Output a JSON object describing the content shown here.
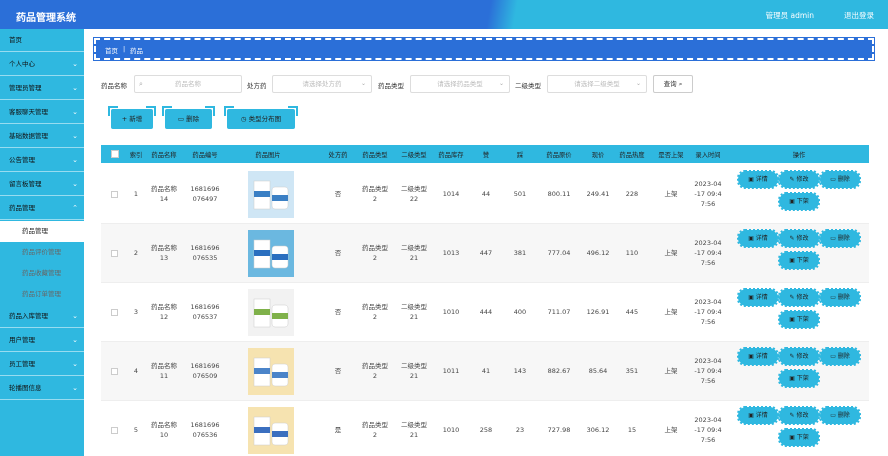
{
  "header": {
    "title": "药品管理系统",
    "user": "管理员 admin",
    "logout": "退出登录"
  },
  "sidebar": {
    "items": [
      {
        "label": "首页",
        "chevron": ""
      },
      {
        "label": "个人中心",
        "chevron": "⌄"
      },
      {
        "label": "管理员管理",
        "chevron": "⌄"
      },
      {
        "label": "客服聊天管理",
        "chevron": "⌄"
      },
      {
        "label": "基础数据管理",
        "chevron": "⌄"
      },
      {
        "label": "公告管理",
        "chevron": "⌄"
      },
      {
        "label": "留言板管理",
        "chevron": "⌄"
      },
      {
        "label": "药品管理",
        "chevron": "⌃"
      }
    ],
    "subitems": [
      "药品管理",
      "药品评价管理",
      "药品收藏管理",
      "药品订单管理"
    ],
    "items_after": [
      {
        "label": "药品入库管理",
        "chevron": "⌄"
      },
      {
        "label": "用户管理",
        "chevron": "⌄"
      },
      {
        "label": "员工管理",
        "chevron": "⌄"
      },
      {
        "label": "轮播图信息",
        "chevron": "⌄"
      }
    ]
  },
  "breadcrumb": {
    "home": "首页",
    "sep": "|",
    "current": "药品"
  },
  "search": {
    "name_label": "药品名称",
    "name_placeholder": "药品名称",
    "rx_label": "处方药",
    "rx_placeholder": "请选择处方药",
    "type_label": "药品类型",
    "type_placeholder": "请选择药品类型",
    "type2_label": "二级类型",
    "type2_placeholder": "请选择二级类型",
    "search_button": "查询"
  },
  "actions": {
    "add": "+ 新增",
    "delete": "删除",
    "chart": "类型分布图"
  },
  "table": {
    "headers": [
      "索引",
      "药品名称",
      "药品编号",
      "药品图片",
      "处方药",
      "药品类型",
      "二级类型",
      "药品库存",
      "赞",
      "踩",
      "药品原价",
      "现价",
      "药品热度",
      "是否上架",
      "录入时间",
      "操作"
    ],
    "op_labels": {
      "detail": "详情",
      "edit": "修改",
      "delete": "删除",
      "off": "下架"
    },
    "rows": [
      {
        "idx": "1",
        "name": "药品名称\n14",
        "code": "1681696\n076497",
        "rx": "否",
        "type": "药品类型\n2",
        "type2": "二级类型\n22",
        "stock": "1014",
        "up": "44",
        "down": "501",
        "price": "800.11",
        "now": "249.41",
        "hot": "228",
        "shelf": "上架",
        "time": "2023-04\n-17 09:4\n7:56"
      },
      {
        "idx": "2",
        "name": "药品名称\n13",
        "code": "1681696\n076535",
        "rx": "否",
        "type": "药品类型\n2",
        "type2": "二级类型\n21",
        "stock": "1013",
        "up": "447",
        "down": "381",
        "price": "777.04",
        "now": "496.12",
        "hot": "110",
        "shelf": "上架",
        "time": "2023-04\n-17 09:4\n7:56"
      },
      {
        "idx": "3",
        "name": "药品名称\n12",
        "code": "1681696\n076537",
        "rx": "否",
        "type": "药品类型\n2",
        "type2": "二级类型\n21",
        "stock": "1010",
        "up": "444",
        "down": "400",
        "price": "711.07",
        "now": "126.91",
        "hot": "445",
        "shelf": "上架",
        "time": "2023-04\n-17 09:4\n7:56"
      },
      {
        "idx": "4",
        "name": "药品名称\n11",
        "code": "1681696\n076509",
        "rx": "否",
        "type": "药品类型\n2",
        "type2": "二级类型\n21",
        "stock": "1011",
        "up": "41",
        "down": "143",
        "price": "882.67",
        "now": "85.64",
        "hot": "351",
        "shelf": "上架",
        "time": "2023-04\n-17 09:4\n7:56"
      },
      {
        "idx": "5",
        "name": "药品名称\n10",
        "code": "1681696\n076536",
        "rx": "是",
        "type": "药品类型\n2",
        "type2": "二级类型\n21",
        "stock": "1010",
        "up": "258",
        "down": "23",
        "price": "727.98",
        "now": "306.12",
        "hot": "15",
        "shelf": "上架",
        "time": "2023-04\n-17 09:4\n7:56"
      }
    ]
  },
  "colors": {
    "primary": "#2b6fd8",
    "accent": "#2fb8e0"
  }
}
